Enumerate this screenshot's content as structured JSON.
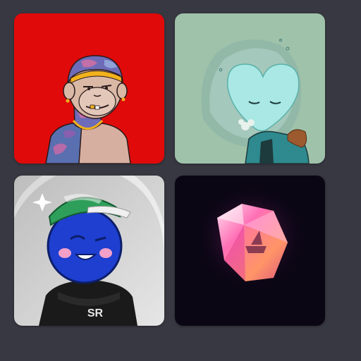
{
  "gallery": {
    "items": [
      {
        "name": "ape-avatar",
        "background": "#E00A0A"
      },
      {
        "name": "ice-heart-avatar",
        "background": "#9FC2AA"
      },
      {
        "name": "blueberry-avatar",
        "background": "#CFCFCF",
        "shirt_text": "SR"
      },
      {
        "name": "crystal-gem",
        "background": "#0A0614"
      }
    ]
  },
  "colors": {
    "page_background": "#383842",
    "gem_pink": "#FF6FB5",
    "blueberry": "#1E3FD0"
  }
}
